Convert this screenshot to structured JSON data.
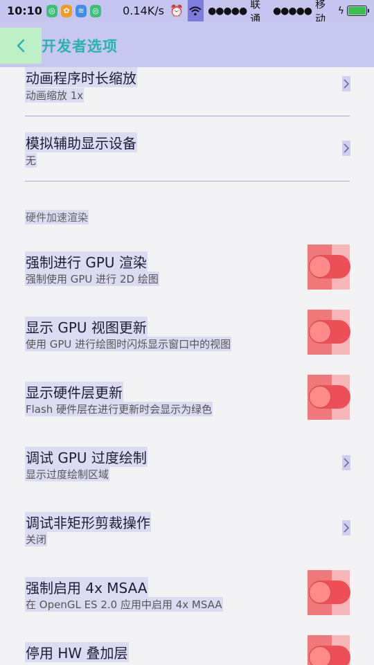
{
  "status_bar": {
    "time": "10:10",
    "speed": "0.14K/s",
    "signal1": "●●●●●",
    "carrier1": "联通",
    "signal2": "●●●●●",
    "carrier2": "移动",
    "battery_level": 1.0,
    "colors": {
      "bar": "#c6c5ef",
      "battery": "#39c24a"
    }
  },
  "header": {
    "title": "开发者选项",
    "colors": {
      "background": "#c8c8ef",
      "title": "#27b4b0",
      "back": "#bff0c5"
    }
  },
  "settings": {
    "animation_scale": {
      "title": "动画程序时长缩放",
      "subtitle": "动画缩放 1x"
    },
    "simulate_display": {
      "title": "模拟辅助显示设备",
      "subtitle": "无"
    },
    "section_hw": "硬件加速渲染",
    "force_gpu": {
      "title": "强制进行 GPU 渲染",
      "subtitle": "强制使用 GPU 进行 2D 绘图",
      "on": false
    },
    "show_gpu_updates": {
      "title": "显示 GPU 视图更新",
      "subtitle": "使用 GPU 进行绘图时闪烁显示窗口中的视图",
      "on": false
    },
    "show_hw_layers": {
      "title": "显示硬件层更新",
      "subtitle": "Flash 硬件层在进行更新时会显示为绿色",
      "on": false
    },
    "debug_overdraw": {
      "title": "调试 GPU 过度绘制",
      "subtitle": "显示过度绘制区域"
    },
    "debug_clip": {
      "title": "调试非矩形剪裁操作",
      "subtitle": "关闭"
    },
    "force_msaa": {
      "title": "强制启用 4x MSAA",
      "subtitle": "在 OpenGL ES 2.0 应用中启用 4x MSAA",
      "on": false
    },
    "disable_hw_overlays": {
      "title": "停用 HW 叠加层",
      "on": false
    }
  },
  "icons": [
    "back-arrow-icon",
    "chevron-right-icon",
    "wifi-icon",
    "alarm-icon",
    "battery-icon",
    "charging-icon"
  ]
}
